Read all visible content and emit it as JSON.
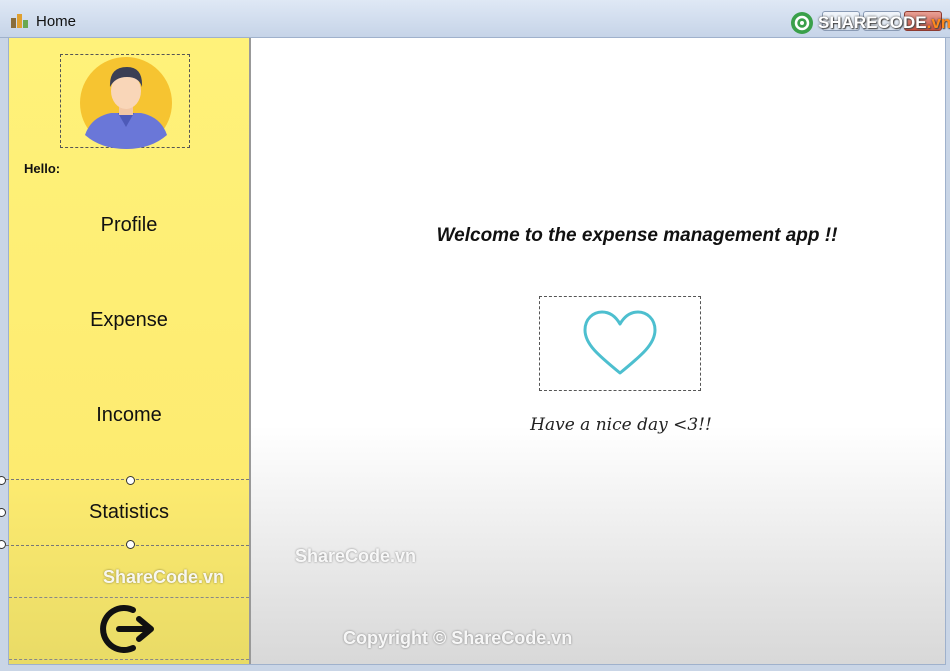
{
  "window": {
    "title": "Home",
    "icon": "app-icon"
  },
  "watermark": {
    "logo_text": "SHARECODE",
    "logo_suffix": ".vn",
    "sidebar_text": "ShareCode.vn",
    "main_text": "ShareCode.vn",
    "copyright": "Copyright © ShareCode.vn"
  },
  "sidebar": {
    "greeting": "Hello:",
    "items": [
      {
        "label": "Profile"
      },
      {
        "label": "Expense"
      },
      {
        "label": "Income"
      },
      {
        "label": "Statistics"
      }
    ],
    "logout_icon": "logout-icon",
    "avatar_icon": "user-avatar-icon"
  },
  "main": {
    "welcome": "Welcome to the expense management app !!",
    "heart_icon": "heart-icon",
    "message": "Have a nice day <3!!"
  },
  "colors": {
    "sidebar_bg": "#fff27a",
    "heart": "#4dbfcf",
    "avatar_bg": "#f6c431",
    "shirt": "#6a77d8"
  }
}
